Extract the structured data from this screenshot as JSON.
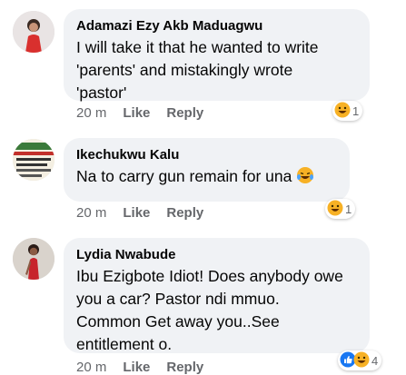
{
  "comments": [
    {
      "author": "Adamazi Ezy Akb Maduagwu",
      "lines": [
        "I will take it that he wanted to write",
        "'parents' and mistakingly wrote",
        "'pastor'"
      ],
      "time": "20 m",
      "like": "Like",
      "reply": "Reply",
      "reaction_icon": "laugh-emoji-icon",
      "reaction_count": "1"
    },
    {
      "author": "Ikechukwu Kalu",
      "lines": [
        "Na to carry gun remain for una"
      ],
      "inline_icon": "laugh-tears-emoji-icon",
      "time": "20 m",
      "like": "Like",
      "reply": "Reply",
      "reaction_icon": "laugh-emoji-icon",
      "reaction_count": "1"
    },
    {
      "author": "Lydia Nwabude",
      "lines": [
        "Ibu Ezigbote Idiot!  Does anybody owe",
        "you a car? Pastor ndi mmuo.",
        "Common Get away you..See",
        "entitlement o."
      ],
      "time": "20 m",
      "like": "Like",
      "reply": "Reply",
      "reaction_icons": [
        "like-icon",
        "laugh-emoji-icon"
      ],
      "reaction_count": "4"
    }
  ],
  "colors": {
    "bubble": "#f0f2f5",
    "meta": "#65676b",
    "like_blue": "#1877f2",
    "emoji_yellow": "#f7b125"
  }
}
